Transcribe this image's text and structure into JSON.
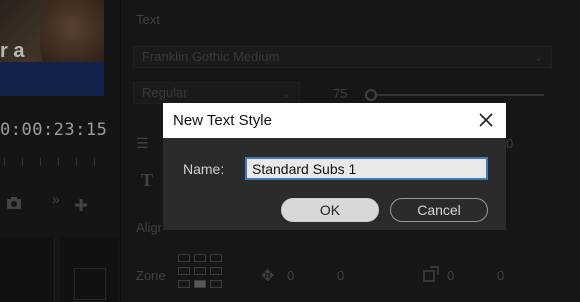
{
  "video": {
    "caption_fragment": "r a"
  },
  "timeline": {
    "timecode": "0:00:23:15"
  },
  "text_panel": {
    "section_label": "Text",
    "font_family": "Franklin Gothic Medium",
    "font_style": "Regular",
    "font_size": "75",
    "align_label": "Aligr",
    "zone_label": "Zone",
    "zone_x1": "0",
    "zone_y1": "0",
    "zone_x2": "0",
    "zone_y2": "0",
    "partial_value": "0"
  },
  "dialog": {
    "title": "New Text Style",
    "name_label": "Name:",
    "name_value": "Standard Subs 1",
    "ok_label": "OK",
    "cancel_label": "Cancel"
  },
  "colors": {
    "accent_focus": "#3c7bc4",
    "dialog_body": "#2b2b2b",
    "dialog_title_bar": "#ffffff"
  },
  "icons": [
    "close-icon",
    "camera-icon",
    "forward-icon",
    "add-icon",
    "align-icon",
    "text-icon",
    "move-icon",
    "scale-icon",
    "zone-grid-icon"
  ]
}
